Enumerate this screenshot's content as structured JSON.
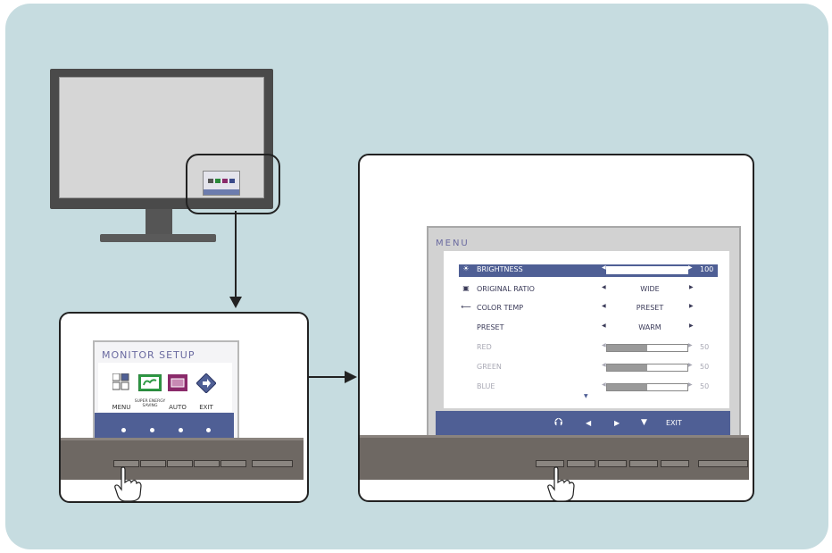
{
  "colors": {
    "background": "#c6dce0",
    "osd_accent": "#4f5f95",
    "stand": "#6e6863"
  },
  "monitor_setup": {
    "title": "MONITOR SETUP",
    "items": [
      {
        "label": "MENU",
        "icon": "menu-grid-icon"
      },
      {
        "label": "SUPER ENERGY SAVING",
        "icon": "energy-saving-icon"
      },
      {
        "label": "AUTO",
        "icon": "auto-adjust-icon"
      },
      {
        "label": "EXIT",
        "icon": "exit-icon"
      }
    ]
  },
  "menu": {
    "title": "MENU",
    "rows": [
      {
        "icon": "brightness-icon",
        "label": "BRIGHTNESS",
        "kind": "slider",
        "value": 100,
        "selected": true
      },
      {
        "icon": "aspect-ratio-icon",
        "label": "ORIGINAL RATIO",
        "kind": "option",
        "value": "WIDE"
      },
      {
        "icon": "color-temp-icon",
        "label": "COLOR TEMP",
        "kind": "option",
        "value": "PRESET"
      },
      {
        "label": "PRESET",
        "kind": "option",
        "value": "WARM"
      },
      {
        "label": "RED",
        "kind": "slider",
        "value": 50,
        "disabled": true
      },
      {
        "label": "GREEN",
        "kind": "slider",
        "value": 50,
        "disabled": true
      },
      {
        "label": "BLUE",
        "kind": "slider",
        "value": 50,
        "disabled": true
      }
    ],
    "nav": {
      "back_icon": "return-icon",
      "left_icon": "triangle-left-icon",
      "right_icon": "triangle-right-icon",
      "down_icon": "triangle-down-icon",
      "exit_label": "EXIT"
    }
  }
}
